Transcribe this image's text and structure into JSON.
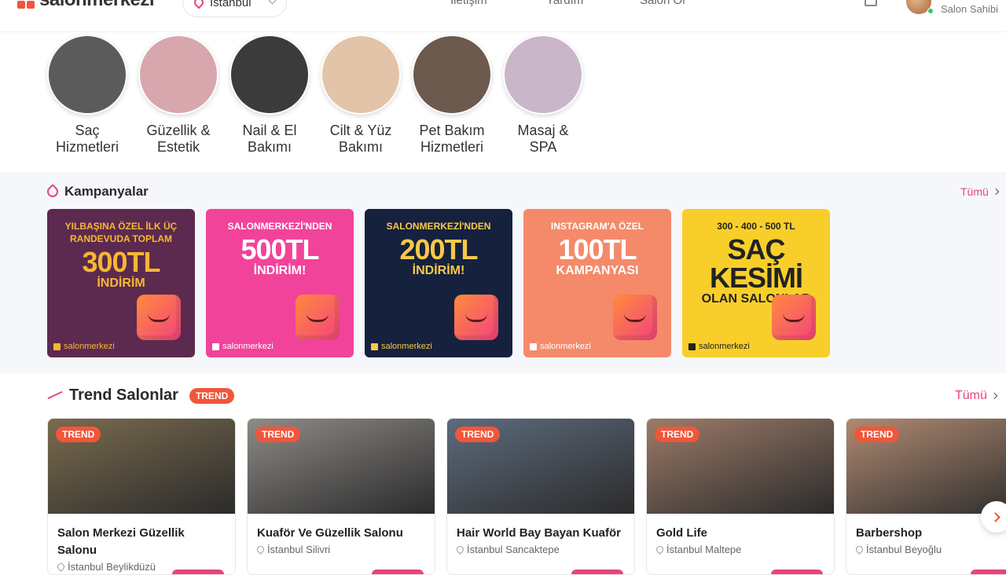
{
  "header": {
    "logo_text": "salonmerkezi",
    "city": "İstanbul",
    "nav": [
      "İletişim",
      "Yardım",
      "Salon Ol"
    ],
    "user_role": "Salon Sahibi"
  },
  "categories": [
    {
      "label": "Saç\nHizmetleri",
      "color": "#5b5b5b"
    },
    {
      "label": "Güzellik &\nEstetik",
      "color": "#d7a7ad"
    },
    {
      "label": "Nail & El\nBakımı",
      "color": "#3b3b3b"
    },
    {
      "label": "Cilt & Yüz\nBakımı",
      "color": "#e3c4a8"
    },
    {
      "label": "Pet Bakım\nHizmetleri",
      "color": "#6b5a4d"
    },
    {
      "label": "Masaj & SPA",
      "color": "#c9b6c8"
    }
  ],
  "campaigns": {
    "title": "Kampanyalar",
    "all_label": "Tümü",
    "items": [
      {
        "top": "YILBAŞINA ÖZEL İLK ÜÇ RANDEVUDA TOPLAM",
        "big": "300TL",
        "mid": "İNDİRİM",
        "brand": "salonmerkezi",
        "bg": "#5c2a4f",
        "fg": "#f7b733"
      },
      {
        "top": "SALONMERKEZİ'NDEN",
        "big": "500TL",
        "mid": "İNDİRİM!",
        "brand": "salonmerkezi",
        "bg": "#f2439a",
        "fg": "#ffffff"
      },
      {
        "top": "SALONMERKEZİ'NDEN",
        "big": "200TL",
        "mid": "İNDİRİM!",
        "brand": "salonmerkezi",
        "bg": "#16213e",
        "fg": "#f7c948"
      },
      {
        "top": "INSTAGRAM'A ÖZEL",
        "big": "100TL",
        "mid": "KAMPANYASI",
        "brand": "salonmerkezi",
        "bg": "#f48a6a",
        "fg": "#ffffff"
      },
      {
        "top": "300 - 400 - 500 TL",
        "big": "SAÇ KESİMİ",
        "mid": "OLAN SALONLAR",
        "brand": "salonmerkezi",
        "bg": "#f8cf2a",
        "fg": "#222222"
      }
    ]
  },
  "trend": {
    "title": "Trend Salonlar",
    "badge": "TREND",
    "all_label": "Tümü",
    "salons": [
      {
        "badge": "TREND",
        "name": "Salon Merkezi Güzellik Salonu",
        "location": "İstanbul Beylikdüzü",
        "img": "#7a6b4e"
      },
      {
        "badge": "TREND",
        "name": "Kuaför Ve Güzellik Salonu",
        "location": "İstanbul Silivri",
        "img": "#8e8a86"
      },
      {
        "badge": "TREND",
        "name": "Hair World Bay Bayan Kuaför",
        "location": "İstanbul Sancaktepe",
        "img": "#5d6b7d"
      },
      {
        "badge": "TREND",
        "name": "Gold Life",
        "location": "İstanbul Maltepe",
        "img": "#9c7b68"
      },
      {
        "badge": "TREND",
        "name": "Barbershop",
        "location": "İstanbul Beyoğlu",
        "img": "#b08a72"
      }
    ]
  },
  "accent": "#e8457c"
}
